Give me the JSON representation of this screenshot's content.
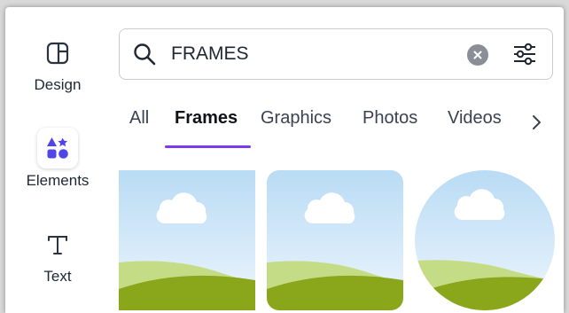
{
  "rail": {
    "items": [
      {
        "label": "Design",
        "icon": "layout-icon"
      },
      {
        "label": "Elements",
        "icon": "shapes-icon"
      },
      {
        "label": "Text",
        "icon": "text-icon"
      }
    ]
  },
  "search": {
    "value": "FRAMES",
    "placeholder": ""
  },
  "tabs": {
    "items": [
      "All",
      "Frames",
      "Graphics",
      "Photos",
      "Videos"
    ],
    "active": "Frames"
  },
  "frames": {
    "items": [
      {
        "shape": "square"
      },
      {
        "shape": "rounded-square"
      },
      {
        "shape": "circle"
      }
    ]
  },
  "colors": {
    "accent": "#7c3aed",
    "elements_icon": "#4f46e5",
    "sky": "#dcecf9",
    "hill_light": "#c5dc86",
    "hill_dark": "#8aa61a"
  }
}
